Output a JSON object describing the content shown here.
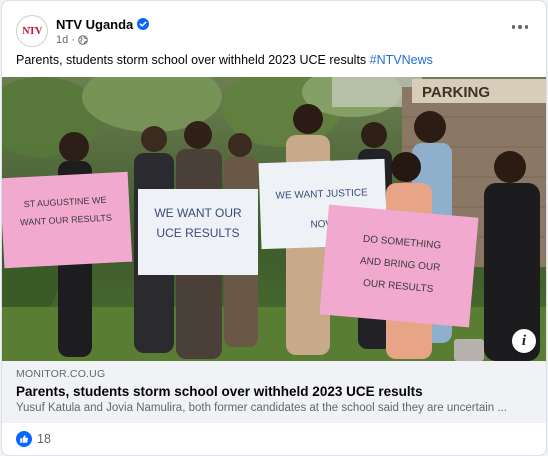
{
  "post": {
    "page_name": "NTV Uganda",
    "page_logo": "NTV",
    "timestamp": "1d",
    "separator": "·",
    "text": "Parents, students storm school over withheld 2023 UCE results",
    "hashtag": "#NTVNews",
    "verified_icon": "verified-badge-icon",
    "audience_icon": "globe-icon"
  },
  "photo": {
    "signs": {
      "sign1": "ST AUGUSTINE WE WANT OUR RESULTS",
      "sign2": "WE WANT OUR UCE RESULTS",
      "sign3": "WE WANT JUSTICE NOW",
      "sign4": "DO SOMETHING AND BRING OUR OUR RESULTS",
      "background_sign": "PARKING"
    },
    "info_label": "i"
  },
  "link_preview": {
    "domain": "MONITOR.CO.UG",
    "title": "Parents, students storm school over withheld 2023 UCE results",
    "description": "Yusuf Katula and Jovia Namulira, both former candidates at the school said they are uncertain ..."
  },
  "reactions": {
    "type": "like",
    "count": "18"
  },
  "colors": {
    "accent_blue": "#0866ff",
    "hashtag_blue": "#216fdb",
    "sign_pink": "#f2a9cf",
    "secondary_text": "#65676b"
  }
}
